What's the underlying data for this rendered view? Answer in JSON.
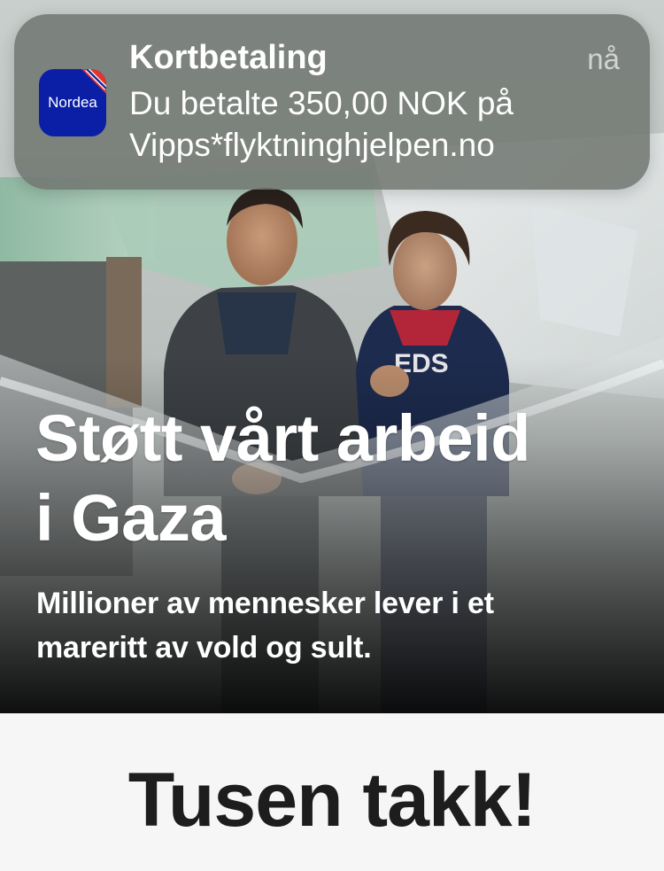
{
  "notification": {
    "app_icon": {
      "name": "nordea-app-icon",
      "brand_text": "Nordea",
      "background_color": "#0a1fa6"
    },
    "title": "Kortbetaling",
    "time": "nå",
    "body_line_1": "Du betalte 350,00 NOK på",
    "body_line_2": "Vipps*flyktninghjelpen.no"
  },
  "hero": {
    "title_line_1": "Støtt vårt arbeid",
    "title_line_2": "i Gaza",
    "subtitle_line_1": "Millioner av mennesker lever i et",
    "subtitle_line_2": "mareritt av vold og sult."
  },
  "thanks": {
    "text": "Tusen takk!"
  },
  "colors": {
    "notification_bg": "#707670",
    "hero_text": "#ffffff",
    "thanks_text": "#1d1d1d",
    "page_bg": "#f6f6f6"
  }
}
